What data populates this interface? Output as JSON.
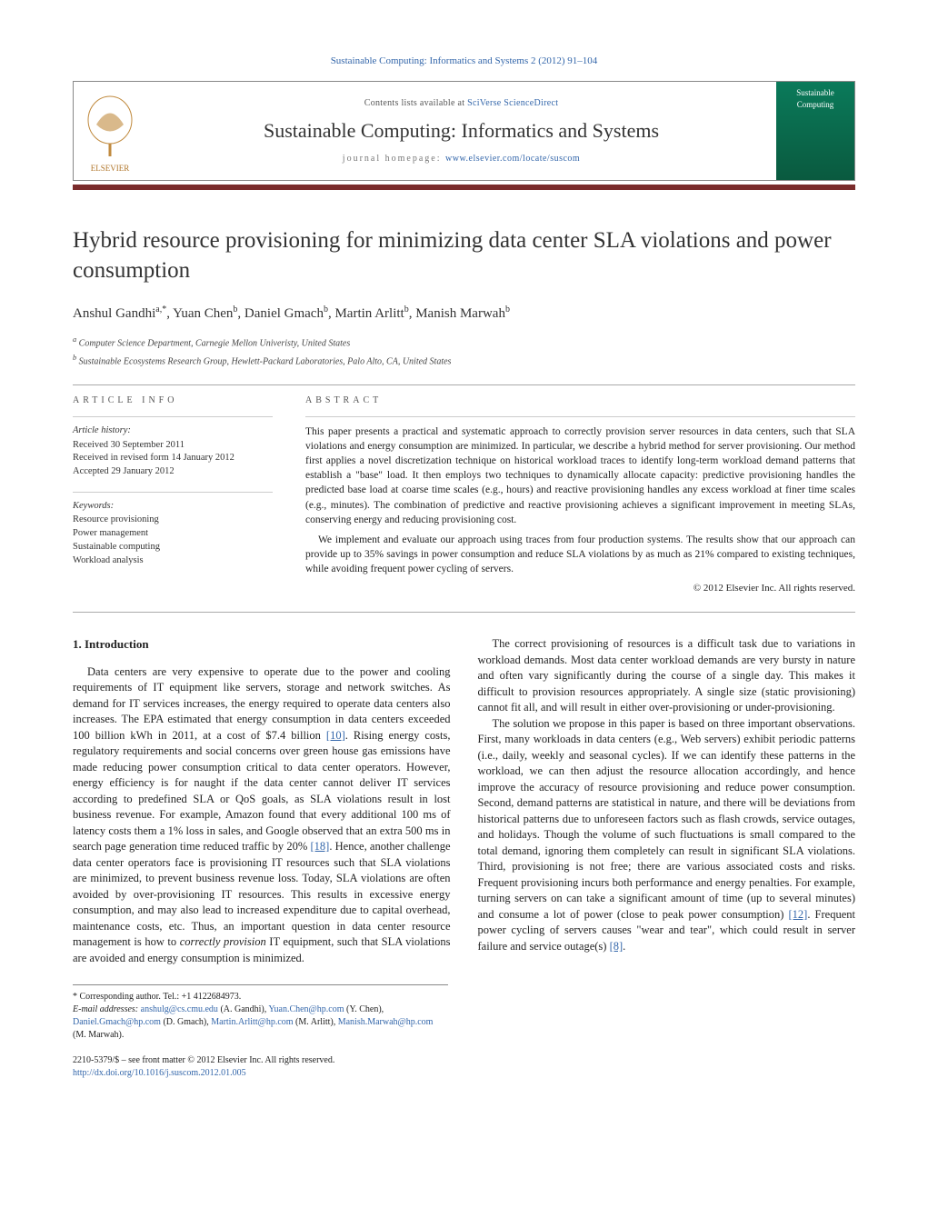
{
  "journal_ref": "Sustainable Computing: Informatics and Systems 2 (2012) 91–104",
  "header": {
    "contents_prefix": "Contents lists available at ",
    "contents_link": "SciVerse ScienceDirect",
    "journal_name": "Sustainable Computing: Informatics and Systems",
    "homepage_prefix": "journal homepage: ",
    "homepage_link": "www.elsevier.com/locate/suscom",
    "publisher_logo_text": "ELSEVIER",
    "cover_logo_text": "Sustainable Computing"
  },
  "title": "Hybrid resource provisioning for minimizing data center SLA violations and power consumption",
  "authors_line": "Anshul Gandhi",
  "authors": [
    {
      "name": "Anshul Gandhi",
      "marks": "a,*"
    },
    {
      "name": "Yuan Chen",
      "marks": "b"
    },
    {
      "name": "Daniel Gmach",
      "marks": "b"
    },
    {
      "name": "Martin Arlitt",
      "marks": "b"
    },
    {
      "name": "Manish Marwah",
      "marks": "b"
    }
  ],
  "affiliations": [
    {
      "mark": "a",
      "text": "Computer Science Department, Carnegie Mellon Univeristy, United States"
    },
    {
      "mark": "b",
      "text": "Sustainable Ecosystems Research Group, Hewlett-Packard Laboratories, Palo Alto, CA, United States"
    }
  ],
  "article_info": {
    "heading": "ARTICLE INFO",
    "history_label": "Article history:",
    "history": [
      "Received 30 September 2011",
      "Received in revised form 14 January 2012",
      "Accepted 29 January 2012"
    ],
    "keywords_label": "Keywords:",
    "keywords": [
      "Resource provisioning",
      "Power management",
      "Sustainable computing",
      "Workload analysis"
    ]
  },
  "abstract": {
    "heading": "ABSTRACT",
    "p1": "This paper presents a practical and systematic approach to correctly provision server resources in data centers, such that SLA violations and energy consumption are minimized. In particular, we describe a hybrid method for server provisioning. Our method first applies a novel discretization technique on historical workload traces to identify long-term workload demand patterns that establish a \"base\" load. It then employs two techniques to dynamically allocate capacity: predictive provisioning handles the predicted base load at coarse time scales (e.g., hours) and reactive provisioning handles any excess workload at finer time scales (e.g., minutes). The combination of predictive and reactive provisioning achieves a significant improvement in meeting SLAs, conserving energy and reducing provisioning cost.",
    "p2": "We implement and evaluate our approach using traces from four production systems. The results show that our approach can provide up to 35% savings in power consumption and reduce SLA violations by as much as 21% compared to existing techniques, while avoiding frequent power cycling of servers.",
    "copyright": "© 2012 Elsevier Inc. All rights reserved."
  },
  "section1_heading": "1.  Introduction",
  "body": {
    "p1a": "Data centers are very expensive to operate due to the power and cooling requirements of IT equipment like servers, storage and network switches. As demand for IT services increases, the energy required to operate data centers also increases. The EPA estimated that energy consumption in data centers exceeded 100 billion kWh in 2011, at a cost of $7.4 billion ",
    "ref1": "[10]",
    "p1b": ". Rising energy costs, regulatory requirements and social concerns over green house gas emissions have made reducing power consumption critical to data center operators. However, energy efficiency is for naught if the data center cannot deliver IT services according to predefined SLA or QoS goals, as SLA violations result in lost business revenue. For example, Amazon found that every additional 100 ms of latency costs them a 1% loss in sales, and Google observed that an extra 500 ms in search page generation time reduced traffic by 20% ",
    "ref2": "[18]",
    "p1c": ". Hence, another challenge data center operators face is provisioning IT resources such that SLA violations are minimized, to prevent business revenue loss. Today, SLA violations are often avoided by over-provisioning IT resources. This results in excessive energy consumption, and may also lead to increased expenditure due to capital overhead, maintenance costs, etc. Thus, an important question in data center resource management is how to ",
    "p1d_em": "correctly provision",
    "p1e": " IT equipment, such that SLA violations are avoided and energy consumption is minimized.",
    "p2": "The correct provisioning of resources is a difficult task due to variations in workload demands. Most data center workload demands are very bursty in nature and often vary significantly during the course of a single day. This makes it difficult to provision resources appropriately. A single size (static provisioning) cannot fit all, and will result in either over-provisioning or under-provisioning.",
    "p3a": "The solution we propose in this paper is based on three important observations. First, many workloads in data centers (e.g., Web servers) exhibit periodic patterns (i.e., daily, weekly and seasonal cycles). If we can identify these patterns in the workload, we can then adjust the resource allocation accordingly, and hence improve the accuracy of resource provisioning and reduce power consumption. Second, demand patterns are statistical in nature, and there will be deviations from historical patterns due to unforeseen factors such as flash crowds, service outages, and holidays. Though the volume of such fluctuations is small compared to the total demand, ignoring them completely can result in significant SLA violations. Third, provisioning is not free; there are various associated costs and risks. Frequent provisioning incurs both performance and energy penalties. For example, turning servers on can take a significant amount of time (up to several minutes) and consume a lot of power (close to peak power consumption) ",
    "ref3": "[12]",
    "p3b": ". Frequent power cycling of servers causes \"wear and tear\", which could result in server failure and service outage(s) ",
    "ref4": "[8]",
    "p3c": "."
  },
  "footnotes": {
    "corr": "* Corresponding author. Tel.: +1 4122684973.",
    "email_label": "E-mail addresses: ",
    "emails": [
      {
        "addr": "anshulg@cs.cmu.edu",
        "who": " (A. Gandhi), "
      },
      {
        "addr": "Yuan.Chen@hp.com",
        "who": " (Y. Chen), "
      },
      {
        "addr": "Daniel.Gmach@hp.com",
        "who": " (D. Gmach), "
      },
      {
        "addr": "Martin.Arlitt@hp.com",
        "who": " (M. Arlitt), "
      },
      {
        "addr": "Manish.Marwah@hp.com",
        "who": " (M. Marwah)."
      }
    ]
  },
  "bottom": {
    "line1": "2210-5379/$ – see front matter © 2012 Elsevier Inc. All rights reserved.",
    "doi": "http://dx.doi.org/10.1016/j.suscom.2012.01.005"
  }
}
